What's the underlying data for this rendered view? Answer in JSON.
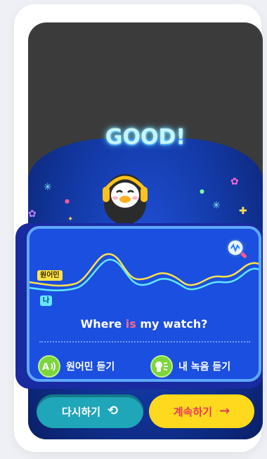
{
  "result": {
    "title": "GOOD!"
  },
  "pronunciation": {
    "native_tag": "원어민",
    "my_tag": "나",
    "sentence_before": "Where ",
    "sentence_highlight": "is",
    "sentence_after": " my watch?",
    "listen_native_label": "원어민 듣기",
    "listen_mine_label": "내 녹음 듣기"
  },
  "actions": {
    "retry_label": "다시하기",
    "continue_label": "계속하기"
  },
  "colors": {
    "native_wave": "#ffe24a",
    "my_wave": "#63e6ff",
    "highlight": "#ff6a8a",
    "retry_button": "#1fa6b8",
    "continue_button": "#ffd91e"
  },
  "icons": {
    "zoom": "magnifier-wave-icon",
    "native_listen": "speaker-a-icon",
    "my_listen": "person-voice-icon",
    "retry": "undo-arrow-icon",
    "continue": "right-arrow-icon"
  }
}
